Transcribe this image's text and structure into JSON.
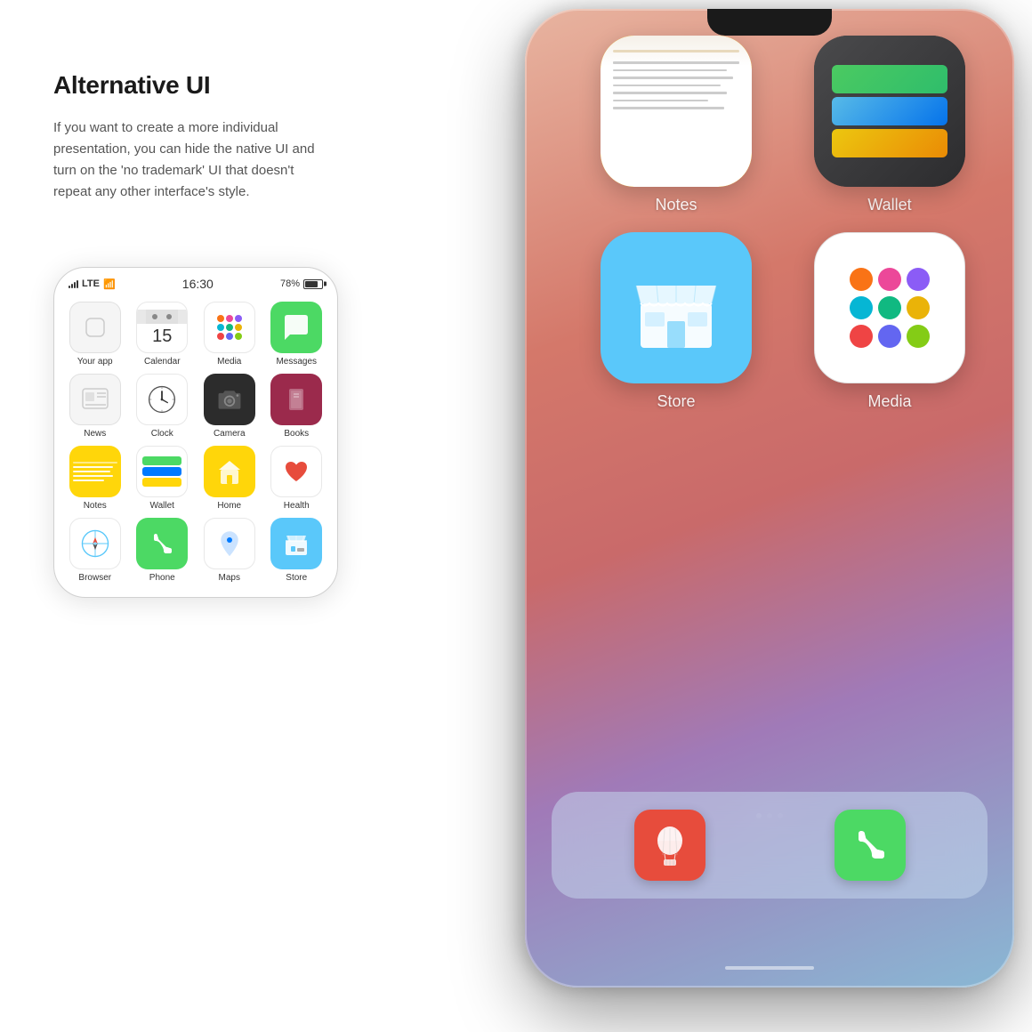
{
  "header": {
    "title": "Alternative UI",
    "description": "If you want to create a more individual presentation, you can hide the native UI and turn on the 'no trademark' UI that doesn't repeat any other interface's style."
  },
  "phone_small": {
    "status": {
      "signal": "LTE",
      "wifi": "wifi",
      "time": "16:30",
      "battery_pct": "78%"
    },
    "apps": [
      {
        "id": "your-app",
        "label": "Your app",
        "icon": "blank"
      },
      {
        "id": "calendar",
        "label": "Calendar",
        "icon": "calendar",
        "date": "15"
      },
      {
        "id": "media",
        "label": "Media",
        "icon": "media"
      },
      {
        "id": "messages",
        "label": "Messages",
        "icon": "messages"
      },
      {
        "id": "news",
        "label": "News",
        "icon": "news"
      },
      {
        "id": "clock",
        "label": "Clock",
        "icon": "clock"
      },
      {
        "id": "camera",
        "label": "Camera",
        "icon": "camera"
      },
      {
        "id": "books",
        "label": "Books",
        "icon": "books"
      },
      {
        "id": "notes",
        "label": "Notes",
        "icon": "notes"
      },
      {
        "id": "wallet",
        "label": "Wallet",
        "icon": "wallet"
      },
      {
        "id": "home",
        "label": "Home",
        "icon": "home"
      },
      {
        "id": "health",
        "label": "Health",
        "icon": "health"
      },
      {
        "id": "browser",
        "label": "Browser",
        "icon": "browser"
      },
      {
        "id": "phone",
        "label": "Phone",
        "icon": "phone"
      },
      {
        "id": "maps",
        "label": "Maps",
        "icon": "maps"
      },
      {
        "id": "store",
        "label": "Store",
        "icon": "store"
      }
    ]
  },
  "phone_large": {
    "apps_visible": [
      {
        "id": "notes",
        "label": "Notes",
        "row": 1,
        "col": 1
      },
      {
        "id": "wallet",
        "label": "Wallet",
        "row": 1,
        "col": 2
      },
      {
        "id": "store",
        "label": "Store",
        "row": 2,
        "col": 1
      },
      {
        "id": "media",
        "label": "Media",
        "row": 2,
        "col": 2
      }
    ],
    "dock": [
      {
        "id": "balloon",
        "label": ""
      },
      {
        "id": "phone",
        "label": ""
      }
    ]
  },
  "colors": {
    "messages_green": "#4cd964",
    "notes_yellow": "#ffd60a",
    "store_blue": "#5ac8fa",
    "books_red": "#9b2a4c",
    "phone_green": "#4cd964",
    "health_red": "#e74c3c",
    "home_yellow": "#ffd60a",
    "balloon_red": "#e74c3c",
    "media_colors": [
      "#f97316",
      "#ec4899",
      "#8b5cf6",
      "#06b6d4",
      "#10b981",
      "#eab308",
      "#ef4444",
      "#6366f1",
      "#84cc16"
    ]
  }
}
